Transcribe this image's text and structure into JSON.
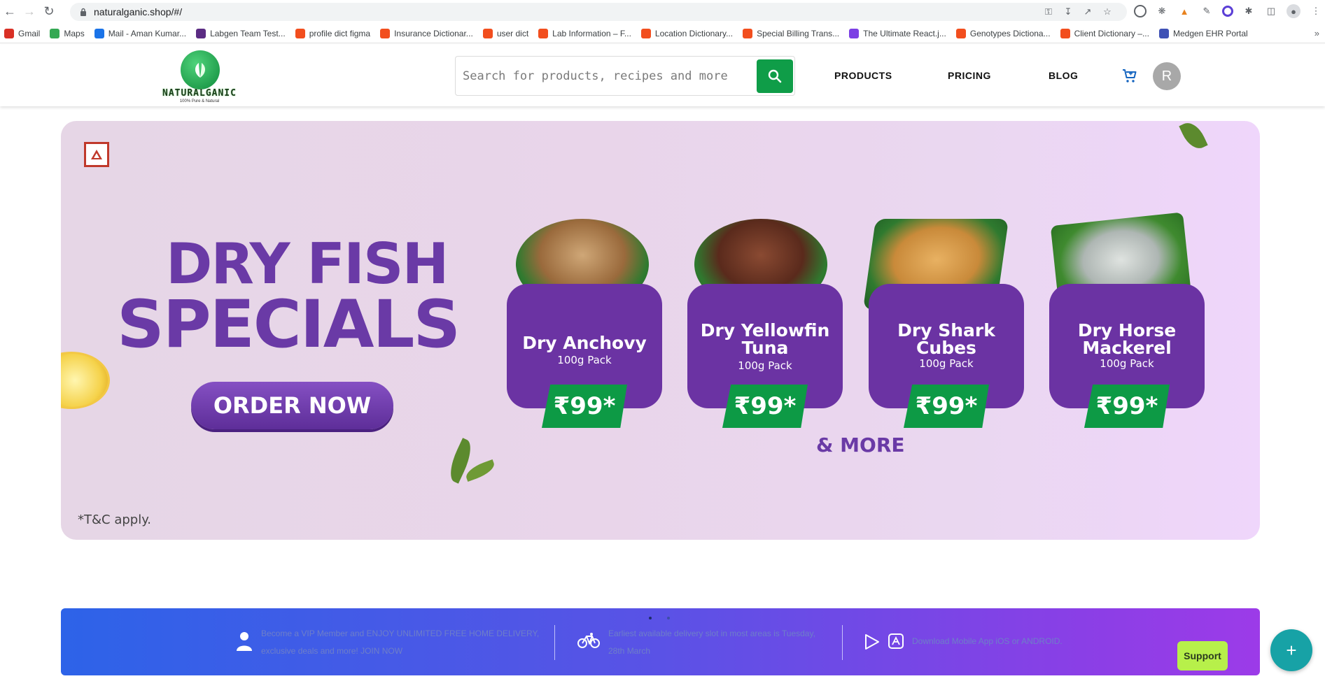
{
  "browser": {
    "url": "naturalganic.shop/#/",
    "bookmarks": [
      {
        "label": "Gmail",
        "color": "#d93025"
      },
      {
        "label": "Maps",
        "color": "#34a853"
      },
      {
        "label": "Mail - Aman Kumar...",
        "color": "#1a73e8"
      },
      {
        "label": "Labgen Team Test...",
        "color": "#5b2c83"
      },
      {
        "label": "profile dict figma",
        "color": "#f24e1e"
      },
      {
        "label": "Insurance Dictionar...",
        "color": "#f24e1e"
      },
      {
        "label": "user dict",
        "color": "#f24e1e"
      },
      {
        "label": "Lab Information – F...",
        "color": "#f24e1e"
      },
      {
        "label": "Location Dictionary...",
        "color": "#f24e1e"
      },
      {
        "label": "Special Billing Trans...",
        "color": "#f24e1e"
      },
      {
        "label": "The Ultimate React.j...",
        "color": "#7b3fe4"
      },
      {
        "label": "Genotypes Dictiona...",
        "color": "#f24e1e"
      },
      {
        "label": "Client Dictionary –...",
        "color": "#f24e1e"
      },
      {
        "label": "Medgen EHR Portal",
        "color": "#3f51b5"
      }
    ],
    "bookmarks_more": "»"
  },
  "header": {
    "logo_text": "NATURALGANIC",
    "logo_tagline": "100% Pure & Natural",
    "search_placeholder": "Search for products, recipes and more",
    "nav": {
      "products": "PRODUCTS",
      "pricing": "PRICING",
      "blog": "BLOG"
    },
    "avatar_initial": "R",
    "accent": "#0f9d48"
  },
  "hero": {
    "title_line1": "DRY FISH",
    "title_line2": "SPECIALS",
    "cta": "ORDER NOW",
    "tnc": "*T&C apply.",
    "and_more": "& MORE",
    "products": [
      {
        "name": "Dry Anchovy",
        "pack": "100g Pack",
        "price": "₹99*"
      },
      {
        "name": "Dry Yellowfin Tuna",
        "pack": "100g Pack",
        "price": "₹99*"
      },
      {
        "name": "Dry Shark Cubes",
        "pack": "100g Pack",
        "price": "₹99*"
      },
      {
        "name": "Dry Horse Mackerel",
        "pack": "100g Pack",
        "price": "₹99*"
      }
    ],
    "brand_purple": "#6a3aa6"
  },
  "info_bar": {
    "vip_line1": "Become a VIP Member and ENJOY UNLIMITED FREE HOME DELIVERY,",
    "vip_line2": "exclusive deals and more! JOIN NOW",
    "delivery_line1": "Earliest available delivery slot in most areas is Tuesday,",
    "delivery_line2": "28th March",
    "app_text": "Download Mobile App iOS or ANDROID.",
    "support": "Support",
    "fab": "+"
  }
}
